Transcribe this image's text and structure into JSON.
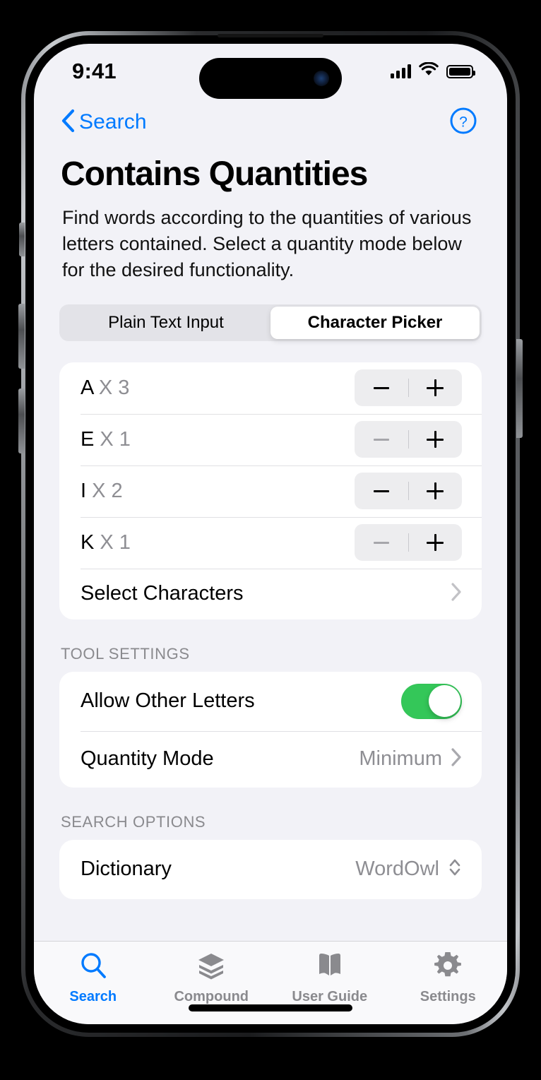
{
  "status_bar": {
    "time": "9:41",
    "signal_icon": "cellular-signal-icon",
    "wifi_icon": "wifi-icon",
    "battery_icon": "battery-icon"
  },
  "nav_bar": {
    "back_label": "Search",
    "back_icon": "chevron-left-icon",
    "help_icon": "question-mark-circle-icon"
  },
  "header": {
    "title": "Contains Quantities",
    "description": "Find words according to the quantities of various letters contained. Select a quantity mode below for the desired functionality."
  },
  "segmented_control": {
    "options": [
      {
        "label": "Plain Text Input",
        "selected": false
      },
      {
        "label": "Character Picker",
        "selected": true
      }
    ]
  },
  "letter_quantities": {
    "rows": [
      {
        "letter": "A",
        "multiplier": "X 3",
        "minus_enabled": true,
        "count": 3
      },
      {
        "letter": "E",
        "multiplier": "X 1",
        "minus_enabled": false,
        "count": 1
      },
      {
        "letter": "I",
        "multiplier": "X 2",
        "minus_enabled": true,
        "count": 2
      },
      {
        "letter": "K",
        "multiplier": "X 1",
        "minus_enabled": false,
        "count": 1
      }
    ],
    "select_characters_label": "Select Characters",
    "select_characters_icon": "chevron-right-icon",
    "stepper_minus_icon": "minus-icon",
    "stepper_plus_icon": "plus-icon"
  },
  "tool_settings": {
    "header": "TOOL SETTINGS",
    "allow_other_letters": {
      "label": "Allow Other Letters",
      "enabled": true
    },
    "quantity_mode": {
      "label": "Quantity Mode",
      "value": "Minimum",
      "icon": "chevron-right-icon"
    }
  },
  "search_options": {
    "header": "SEARCH OPTIONS",
    "dictionary": {
      "label": "Dictionary",
      "value": "WordOwl",
      "icon": "chevron-up-down-icon"
    }
  },
  "tab_bar": {
    "tabs": [
      {
        "label": "Search",
        "icon": "magnifying-glass-icon",
        "active": true
      },
      {
        "label": "Compound",
        "icon": "layers-icon",
        "active": false
      },
      {
        "label": "User Guide",
        "icon": "book-icon",
        "active": false
      },
      {
        "label": "Settings",
        "icon": "gear-icon",
        "active": false
      }
    ]
  },
  "colors": {
    "accent": "#007AFF",
    "toggle_on": "#34C759",
    "background": "#F2F2F7",
    "card": "#FFFFFF",
    "secondary_text": "#8E8E93"
  }
}
